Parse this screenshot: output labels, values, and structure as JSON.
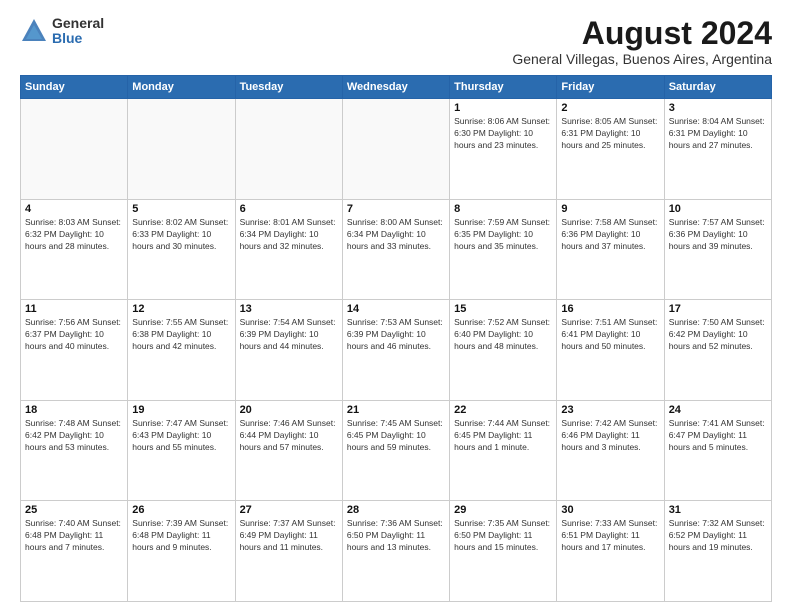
{
  "logo": {
    "general": "General",
    "blue": "Blue"
  },
  "title": "August 2024",
  "location": "General Villegas, Buenos Aires, Argentina",
  "headers": [
    "Sunday",
    "Monday",
    "Tuesday",
    "Wednesday",
    "Thursday",
    "Friday",
    "Saturday"
  ],
  "weeks": [
    [
      {
        "day": "",
        "info": ""
      },
      {
        "day": "",
        "info": ""
      },
      {
        "day": "",
        "info": ""
      },
      {
        "day": "",
        "info": ""
      },
      {
        "day": "1",
        "info": "Sunrise: 8:06 AM\nSunset: 6:30 PM\nDaylight: 10 hours\nand 23 minutes."
      },
      {
        "day": "2",
        "info": "Sunrise: 8:05 AM\nSunset: 6:31 PM\nDaylight: 10 hours\nand 25 minutes."
      },
      {
        "day": "3",
        "info": "Sunrise: 8:04 AM\nSunset: 6:31 PM\nDaylight: 10 hours\nand 27 minutes."
      }
    ],
    [
      {
        "day": "4",
        "info": "Sunrise: 8:03 AM\nSunset: 6:32 PM\nDaylight: 10 hours\nand 28 minutes."
      },
      {
        "day": "5",
        "info": "Sunrise: 8:02 AM\nSunset: 6:33 PM\nDaylight: 10 hours\nand 30 minutes."
      },
      {
        "day": "6",
        "info": "Sunrise: 8:01 AM\nSunset: 6:34 PM\nDaylight: 10 hours\nand 32 minutes."
      },
      {
        "day": "7",
        "info": "Sunrise: 8:00 AM\nSunset: 6:34 PM\nDaylight: 10 hours\nand 33 minutes."
      },
      {
        "day": "8",
        "info": "Sunrise: 7:59 AM\nSunset: 6:35 PM\nDaylight: 10 hours\nand 35 minutes."
      },
      {
        "day": "9",
        "info": "Sunrise: 7:58 AM\nSunset: 6:36 PM\nDaylight: 10 hours\nand 37 minutes."
      },
      {
        "day": "10",
        "info": "Sunrise: 7:57 AM\nSunset: 6:36 PM\nDaylight: 10 hours\nand 39 minutes."
      }
    ],
    [
      {
        "day": "11",
        "info": "Sunrise: 7:56 AM\nSunset: 6:37 PM\nDaylight: 10 hours\nand 40 minutes."
      },
      {
        "day": "12",
        "info": "Sunrise: 7:55 AM\nSunset: 6:38 PM\nDaylight: 10 hours\nand 42 minutes."
      },
      {
        "day": "13",
        "info": "Sunrise: 7:54 AM\nSunset: 6:39 PM\nDaylight: 10 hours\nand 44 minutes."
      },
      {
        "day": "14",
        "info": "Sunrise: 7:53 AM\nSunset: 6:39 PM\nDaylight: 10 hours\nand 46 minutes."
      },
      {
        "day": "15",
        "info": "Sunrise: 7:52 AM\nSunset: 6:40 PM\nDaylight: 10 hours\nand 48 minutes."
      },
      {
        "day": "16",
        "info": "Sunrise: 7:51 AM\nSunset: 6:41 PM\nDaylight: 10 hours\nand 50 minutes."
      },
      {
        "day": "17",
        "info": "Sunrise: 7:50 AM\nSunset: 6:42 PM\nDaylight: 10 hours\nand 52 minutes."
      }
    ],
    [
      {
        "day": "18",
        "info": "Sunrise: 7:48 AM\nSunset: 6:42 PM\nDaylight: 10 hours\nand 53 minutes."
      },
      {
        "day": "19",
        "info": "Sunrise: 7:47 AM\nSunset: 6:43 PM\nDaylight: 10 hours\nand 55 minutes."
      },
      {
        "day": "20",
        "info": "Sunrise: 7:46 AM\nSunset: 6:44 PM\nDaylight: 10 hours\nand 57 minutes."
      },
      {
        "day": "21",
        "info": "Sunrise: 7:45 AM\nSunset: 6:45 PM\nDaylight: 10 hours\nand 59 minutes."
      },
      {
        "day": "22",
        "info": "Sunrise: 7:44 AM\nSunset: 6:45 PM\nDaylight: 11 hours\nand 1 minute."
      },
      {
        "day": "23",
        "info": "Sunrise: 7:42 AM\nSunset: 6:46 PM\nDaylight: 11 hours\nand 3 minutes."
      },
      {
        "day": "24",
        "info": "Sunrise: 7:41 AM\nSunset: 6:47 PM\nDaylight: 11 hours\nand 5 minutes."
      }
    ],
    [
      {
        "day": "25",
        "info": "Sunrise: 7:40 AM\nSunset: 6:48 PM\nDaylight: 11 hours\nand 7 minutes."
      },
      {
        "day": "26",
        "info": "Sunrise: 7:39 AM\nSunset: 6:48 PM\nDaylight: 11 hours\nand 9 minutes."
      },
      {
        "day": "27",
        "info": "Sunrise: 7:37 AM\nSunset: 6:49 PM\nDaylight: 11 hours\nand 11 minutes."
      },
      {
        "day": "28",
        "info": "Sunrise: 7:36 AM\nSunset: 6:50 PM\nDaylight: 11 hours\nand 13 minutes."
      },
      {
        "day": "29",
        "info": "Sunrise: 7:35 AM\nSunset: 6:50 PM\nDaylight: 11 hours\nand 15 minutes."
      },
      {
        "day": "30",
        "info": "Sunrise: 7:33 AM\nSunset: 6:51 PM\nDaylight: 11 hours\nand 17 minutes."
      },
      {
        "day": "31",
        "info": "Sunrise: 7:32 AM\nSunset: 6:52 PM\nDaylight: 11 hours\nand 19 minutes."
      }
    ]
  ]
}
